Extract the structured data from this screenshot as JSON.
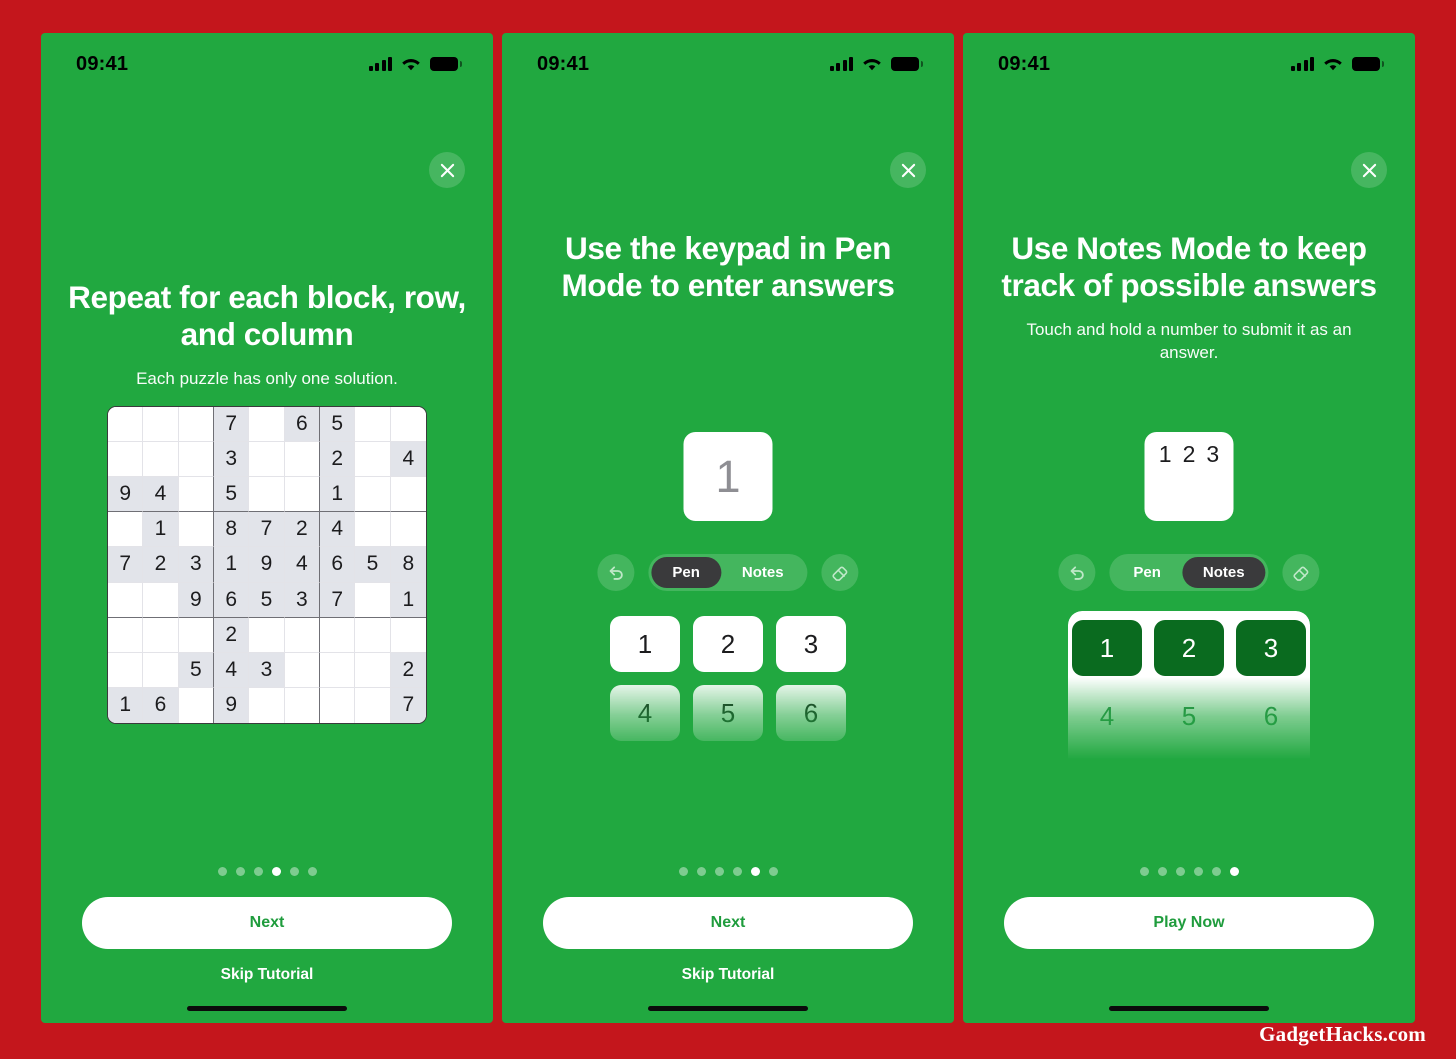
{
  "theme": {
    "page_bg": "#c4161c",
    "screen_bg": "#21a840",
    "accent_white": "#ffffff",
    "button_text_green": "#1f9c3d",
    "segment_active_bg": "#3a3a3c",
    "note_key_bg": "#0a6b1f",
    "grid_shaded_cell": "#e2e4ea"
  },
  "watermark": "GadgetHacks.com",
  "status_bar": {
    "time": "09:41",
    "icons": [
      "cellular-signal-icon",
      "wifi-icon",
      "battery-icon"
    ]
  },
  "screens": [
    {
      "id": "screen-repeat-blocks",
      "close_icon": "close-icon",
      "title": "Repeat for each block, row, and column",
      "subtitle": "Each puzzle has only one solution.",
      "dots": {
        "count": 6,
        "active": 4
      },
      "primary_button": "Next",
      "skip_button": "Skip Tutorial",
      "sudoku": {
        "rows": [
          [
            "",
            "",
            "",
            "7",
            "",
            "6",
            "5",
            "",
            ""
          ],
          [
            "",
            "",
            "",
            "3",
            "",
            "",
            "2",
            "",
            "4"
          ],
          [
            "9",
            "4",
            "",
            "5",
            "",
            "",
            "1",
            "",
            ""
          ],
          [
            "",
            "1",
            "",
            "8",
            "7",
            "2",
            "4",
            "",
            ""
          ],
          [
            "7",
            "2",
            "3",
            "1",
            "9",
            "4",
            "6",
            "5",
            "8"
          ],
          [
            "",
            "",
            "9",
            "6",
            "5",
            "3",
            "7",
            "",
            "1"
          ],
          [
            "",
            "",
            "",
            "2",
            "",
            "",
            "",
            "",
            ""
          ],
          [
            "",
            "",
            "5",
            "4",
            "3",
            "",
            "",
            "",
            "2"
          ],
          [
            "1",
            "6",
            "",
            "9",
            "",
            "",
            "",
            "",
            "7"
          ]
        ]
      }
    },
    {
      "id": "screen-pen-mode",
      "close_icon": "close-icon",
      "title": "Use the keypad in Pen Mode to enter answers",
      "subtitle": "",
      "answer_cell": {
        "mode": "pen",
        "value": "1"
      },
      "toolbar": {
        "undo_icon": "undo-icon",
        "eraser_icon": "eraser-icon",
        "segments": [
          "Pen",
          "Notes"
        ],
        "active_segment": "Pen"
      },
      "keypad": {
        "visible_keys": [
          "1",
          "2",
          "3",
          "4",
          "5",
          "6"
        ]
      },
      "dots": {
        "count": 6,
        "active": 5
      },
      "primary_button": "Next",
      "skip_button": "Skip Tutorial"
    },
    {
      "id": "screen-notes-mode",
      "close_icon": "close-icon",
      "title": "Use Notes Mode to keep track of possible answers",
      "subtitle": "Touch and hold a number to submit it as an answer.",
      "answer_cell": {
        "mode": "notes",
        "notes": [
          "1",
          "2",
          "3"
        ]
      },
      "toolbar": {
        "undo_icon": "undo-icon",
        "eraser_icon": "eraser-icon",
        "segments": [
          "Pen",
          "Notes"
        ],
        "active_segment": "Notes"
      },
      "keypad": {
        "visible_keys": [
          "1",
          "2",
          "3",
          "4",
          "5",
          "6"
        ]
      },
      "dots": {
        "count": 6,
        "active": 6
      },
      "primary_button": "Play Now",
      "skip_button": ""
    }
  ]
}
